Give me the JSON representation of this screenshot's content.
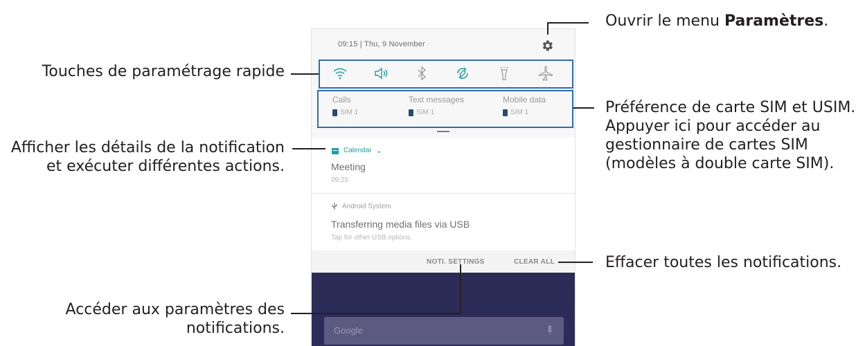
{
  "callouts": {
    "settings_menu_prefix": "Ouvrir le menu ",
    "settings_menu_bold": "Paramètres",
    "settings_menu_suffix": ".",
    "quick_settings": "Touches de paramétrage rapide",
    "sim_line1": "Préférence de carte SIM et USIM.",
    "sim_line2": "Appuyer ici pour accéder au",
    "sim_line3": "gestionnaire de cartes SIM",
    "sim_line4": "(modèles à double carte SIM).",
    "notif_line1": "Afficher les détails de la notification",
    "notif_line2": "et exécuter différentes actions.",
    "clear_all": "Effacer toutes les notifications.",
    "noti_settings_line1": "Accéder aux paramètres des",
    "noti_settings_line2": "notifications."
  },
  "phone": {
    "header_time": "09:15 | Thu, 9 November",
    "icons": [
      "wifi-icon",
      "sound-icon",
      "bluetooth-icon",
      "auto-rotate-icon",
      "flashlight-icon",
      "airplane-icon",
      "gear-icon"
    ],
    "sim": [
      {
        "title": "Calls",
        "value": "SIM 1"
      },
      {
        "title": "Text messages",
        "value": "SIM 1"
      },
      {
        "title": "Mobile data",
        "value": "SIM 1"
      }
    ],
    "notif1": {
      "app": "Calendar",
      "title": "Meeting",
      "sub": "09:25"
    },
    "notif2": {
      "app": "Android System",
      "title": "Transferring media files via USB",
      "sub": "Tap for other USB options."
    },
    "actions": {
      "noti_settings": "NOTI. SETTINGS",
      "clear_all": "CLEAR ALL"
    },
    "search_label": "Google"
  },
  "colors": {
    "highlight": "#2f6bb0",
    "accent_teal": "#1a9ea4",
    "wallpaper": "#2c2c56"
  }
}
